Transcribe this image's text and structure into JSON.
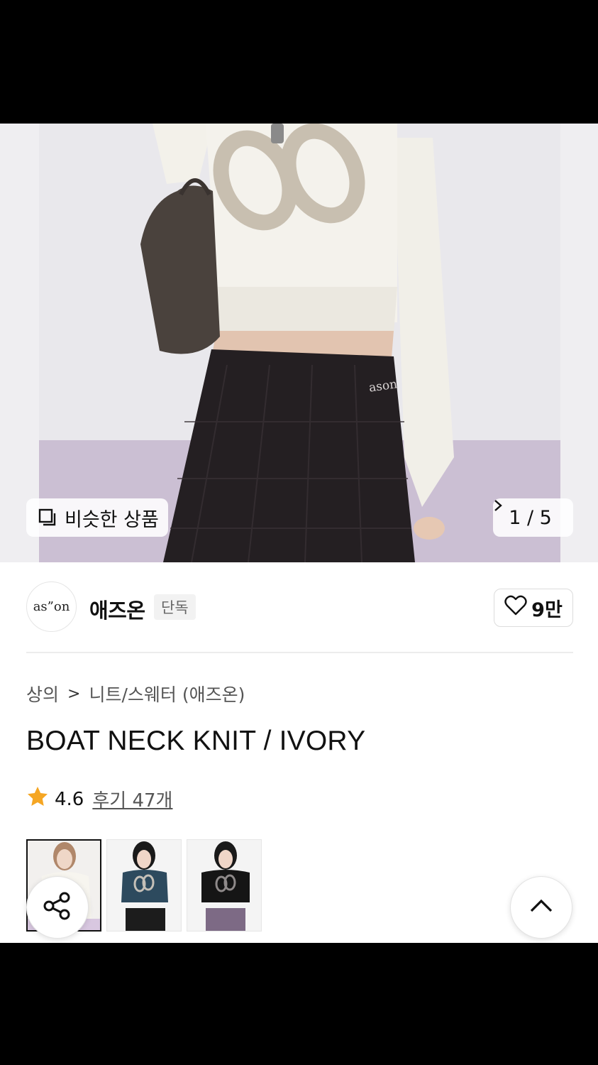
{
  "hero": {
    "similar_label": "비슷한 상품",
    "counter": "1 / 5",
    "shirt_print": "ason",
    "icons": {
      "similar": "similar-products-icon",
      "next": "chevron-right-icon"
    }
  },
  "brand": {
    "logo_text": "as”on",
    "name": "애즈온",
    "tag": "단독",
    "likes": "9만",
    "icons": {
      "like": "heart-outline-icon"
    }
  },
  "product": {
    "breadcrumb": [
      "상의",
      "니트/스웨터 (애즈온)"
    ],
    "breadcrumb_separator": ">",
    "title": "BOAT NECK KNIT / IVORY",
    "rating": "4.6",
    "reviews": "후기 47개",
    "rating_color": "#f5a623"
  },
  "thumbnails": [
    {
      "alt": "ivory",
      "active": true
    },
    {
      "alt": "navy",
      "active": false
    },
    {
      "alt": "black",
      "active": false
    }
  ],
  "floating": {
    "share_icon": "share-icon",
    "top_icon": "chevron-up-icon"
  }
}
